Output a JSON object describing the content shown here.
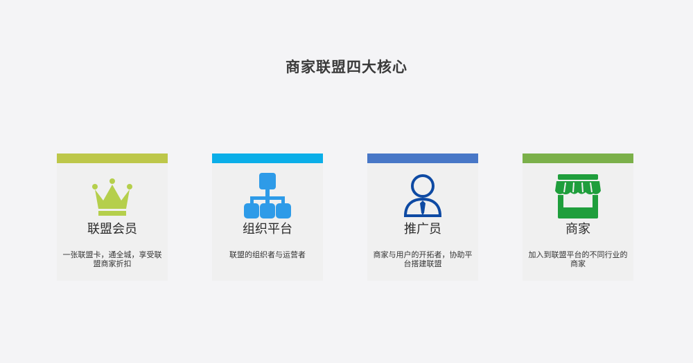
{
  "section": {
    "title": "商家联盟四大核心"
  },
  "cards": [
    {
      "title": "联盟会员",
      "description": "一张联盟卡，通全城，享受联盟商家折扣",
      "accent_color": "#bdc74a",
      "icon": "crown-icon",
      "icon_color": "#b5cf4c"
    },
    {
      "title": "组织平台",
      "description": "联盟的组织者与运营者",
      "accent_color": "#0aaee8",
      "icon": "org-chart-icon",
      "icon_color": "#2e9be8"
    },
    {
      "title": "推广员",
      "description": "商家与用户的开拓者，协助平台搭建联盟",
      "accent_color": "#4877c7",
      "icon": "user-icon",
      "icon_color": "#0e4aa3"
    },
    {
      "title": "商家",
      "description": "加入到联盟平台的不同行业的商家",
      "accent_color": "#7bb04a",
      "icon": "store-icon",
      "icon_color": "#1f9e3c"
    }
  ]
}
